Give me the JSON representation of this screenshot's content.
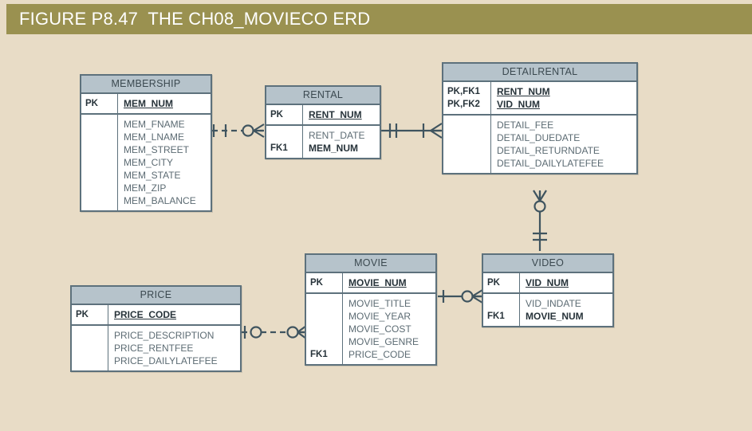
{
  "figure": {
    "title": "FIGURE P8.47  THE CH08_MOVIECO ERD",
    "bar_color": "#9a9150",
    "background_color": "#e8dcc6",
    "entity_header_color": "#b6c3cb",
    "entity_border_color": "#5d717c"
  },
  "entities": {
    "membership": {
      "name": "MEMBERSHIP",
      "key_labels": [
        "PK"
      ],
      "keys": [
        "MEM_NUM"
      ],
      "attr_key_labels": [
        ""
      ],
      "attributes": [
        "MEM_FNAME",
        "MEM_LNAME",
        "MEM_STREET",
        "MEM_CITY",
        "MEM_STATE",
        "MEM_ZIP",
        "MEM_BALANCE"
      ]
    },
    "rental": {
      "name": "RENTAL",
      "key_labels": [
        "PK"
      ],
      "keys": [
        "RENT_NUM"
      ],
      "attr_key_labels": [
        "FK1"
      ],
      "attributes": [
        "RENT_DATE",
        "MEM_NUM"
      ]
    },
    "detailrental": {
      "name": "DETAILRENTAL",
      "key_labels": [
        "PK,FK1",
        "PK,FK2"
      ],
      "keys": [
        "RENT_NUM",
        "VID_NUM"
      ],
      "attr_key_labels": [
        ""
      ],
      "attributes": [
        "DETAIL_FEE",
        "DETAIL_DUEDATE",
        "DETAIL_RETURNDATE",
        "DETAIL_DAILYLATEFEE"
      ]
    },
    "movie": {
      "name": "MOVIE",
      "key_labels": [
        "PK"
      ],
      "keys": [
        "MOVIE_NUM"
      ],
      "attr_key_labels": [
        "FK1"
      ],
      "attributes": [
        "MOVIE_TITLE",
        "MOVIE_YEAR",
        "MOVIE_COST",
        "MOVIE_GENRE",
        "PRICE_CODE"
      ]
    },
    "video": {
      "name": "VIDEO",
      "key_labels": [
        "PK"
      ],
      "keys": [
        "VID_NUM"
      ],
      "attr_key_labels": [
        "FK1"
      ],
      "attributes": [
        "VID_INDATE",
        "MOVIE_NUM"
      ]
    },
    "price": {
      "name": "PRICE",
      "key_labels": [
        "PK"
      ],
      "keys": [
        "PRICE_CODE"
      ],
      "attr_key_labels": [
        ""
      ],
      "attributes": [
        "PRICE_DESCRIPTION",
        "PRICE_RENTFEE",
        "PRICE_DAILYLATEFEE"
      ]
    }
  },
  "relationships": [
    {
      "id": "membership-rental",
      "from": "MEMBERSHIP",
      "to": "RENTAL",
      "line_style": "dashed",
      "from_cardinality": "one-mandatory",
      "to_cardinality": "zero-or-many"
    },
    {
      "id": "rental-detailrental",
      "from": "RENTAL",
      "to": "DETAILRENTAL",
      "line_style": "solid",
      "from_cardinality": "one-and-only-one",
      "to_cardinality": "one-or-many"
    },
    {
      "id": "video-detailrental",
      "from": "VIDEO",
      "to": "DETAILRENTAL",
      "line_style": "solid",
      "from_cardinality": "one-and-only-one",
      "to_cardinality": "zero-or-many"
    },
    {
      "id": "movie-video",
      "from": "MOVIE",
      "to": "VIDEO",
      "line_style": "solid",
      "from_cardinality": "one-mandatory",
      "to_cardinality": "zero-or-many"
    },
    {
      "id": "price-movie",
      "from": "PRICE",
      "to": "MOVIE",
      "line_style": "dashed",
      "from_cardinality": "zero-or-one",
      "to_cardinality": "zero-or-many"
    }
  ]
}
